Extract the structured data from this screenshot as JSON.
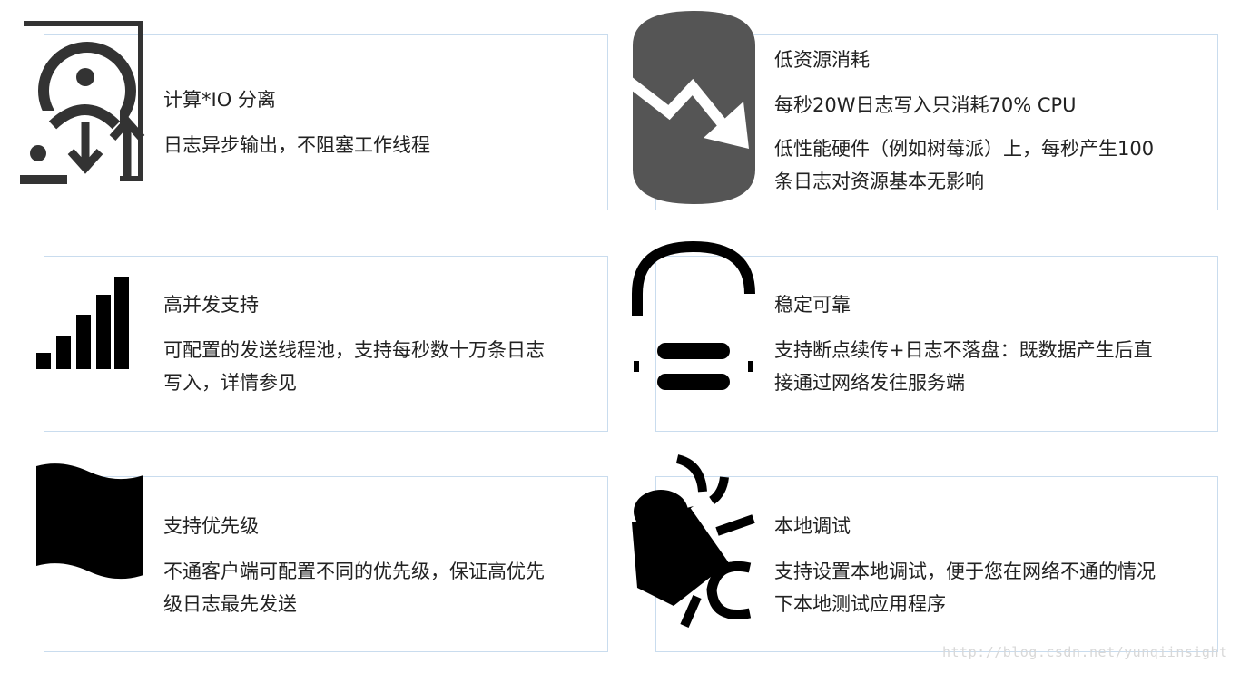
{
  "features": [
    {
      "icon": "user-io-icon",
      "title": "计算*IO 分离",
      "lines": [
        "日志异步输出，不阻塞工作线程"
      ]
    },
    {
      "icon": "trend-down-icon",
      "title": "低资源消耗",
      "lines": [
        "每秒20W日志写入只消耗70% CPU",
        "低性能硬件（例如树莓派）上，每秒产生100",
        "条日志对资源基本无影响"
      ]
    },
    {
      "icon": "signal-bars-icon",
      "title": "高并发支持",
      "lines": [
        "可配置的发送线程池，支持每秒数十万条日志",
        "写入，详情参见"
      ]
    },
    {
      "icon": "cloud-icon",
      "title": "稳定可靠",
      "lines": [
        "支持断点续传+日志不落盘：既数据产生后直",
        "接通过网络发往服务端"
      ]
    },
    {
      "icon": "flag-icon",
      "title": "支持优先级",
      "lines": [
        "不通客户端可配置不同的优先级，保证高优先",
        "级日志最先发送"
      ]
    },
    {
      "icon": "bug-icon",
      "title": "本地调试",
      "lines": [
        "支持设置本地调试，便于您在网络不通的情况",
        "下本地测试应用程序"
      ]
    }
  ],
  "watermark": "http://blog.csdn.net/yunqiinsight"
}
